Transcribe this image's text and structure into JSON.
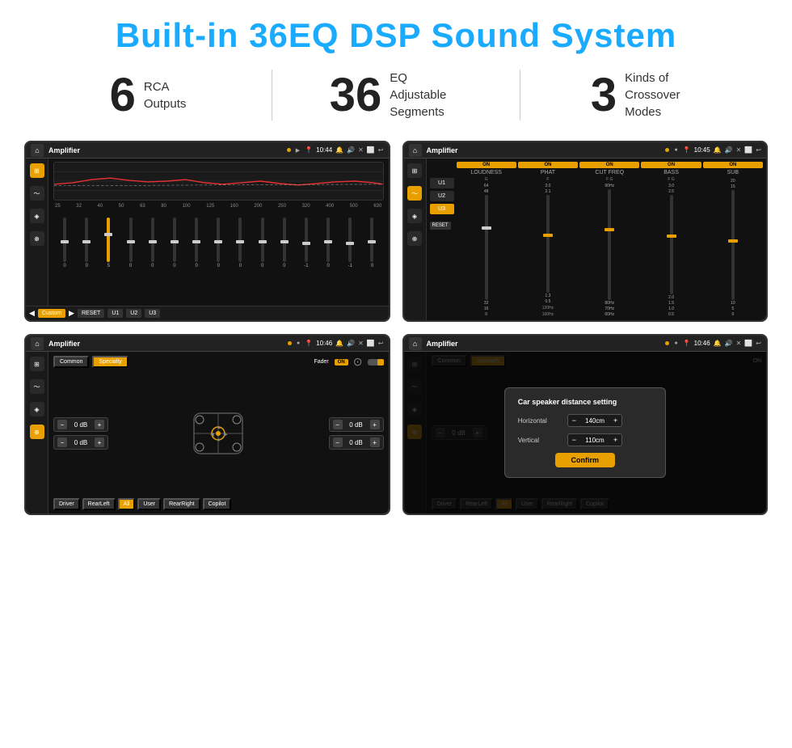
{
  "title": "Built-in 36EQ DSP Sound System",
  "stats": [
    {
      "number": "6",
      "label": "RCA\nOutputs"
    },
    {
      "number": "36",
      "label": "EQ Adjustable\nSegments"
    },
    {
      "number": "3",
      "label": "Kinds of\nCrossover Modes"
    }
  ],
  "screens": [
    {
      "id": "screen1",
      "topbar": {
        "title": "Amplifier",
        "time": "10:44"
      },
      "type": "eq",
      "freqs": [
        "25",
        "32",
        "40",
        "50",
        "63",
        "80",
        "100",
        "125",
        "160",
        "200",
        "250",
        "320",
        "400",
        "500",
        "630"
      ],
      "sliders": [
        0,
        0,
        5,
        0,
        0,
        0,
        0,
        0,
        0,
        0,
        0,
        -1,
        0,
        -1,
        0
      ],
      "presets": [
        "Custom",
        "RESET",
        "U1",
        "U2",
        "U3"
      ]
    },
    {
      "id": "screen2",
      "topbar": {
        "title": "Amplifier",
        "time": "10:45"
      },
      "type": "crossover",
      "presets": [
        "U1",
        "U2",
        "U3"
      ],
      "channels": [
        {
          "label": "LOUDNESS",
          "on": true
        },
        {
          "label": "PHAT",
          "on": true
        },
        {
          "label": "CUT FREQ",
          "on": true
        },
        {
          "label": "BASS",
          "on": true
        },
        {
          "label": "SUB",
          "on": true
        }
      ]
    },
    {
      "id": "screen3",
      "topbar": {
        "title": "Amplifier",
        "time": "10:46"
      },
      "type": "speaker",
      "tabs": [
        "Common",
        "Specialty"
      ],
      "controls": [
        {
          "val": "0 dB"
        },
        {
          "val": "0 dB"
        },
        {
          "val": "0 dB"
        },
        {
          "val": "0 dB"
        }
      ],
      "fader": "ON",
      "buttons": [
        "Driver",
        "RearLeft",
        "All",
        "User",
        "RearRight",
        "Copilot"
      ]
    },
    {
      "id": "screen4",
      "topbar": {
        "title": "Amplifier",
        "time": "10:46"
      },
      "type": "speaker-dialog",
      "tabs": [
        "Common",
        "Specialty"
      ],
      "dialog": {
        "title": "Car speaker distance setting",
        "fields": [
          {
            "label": "Horizontal",
            "value": "140cm"
          },
          {
            "label": "Vertical",
            "value": "110cm"
          }
        ],
        "confirm": "Confirm"
      },
      "controls": [
        {
          "val": "0 dB"
        },
        {
          "val": "0 dB"
        }
      ]
    }
  ]
}
